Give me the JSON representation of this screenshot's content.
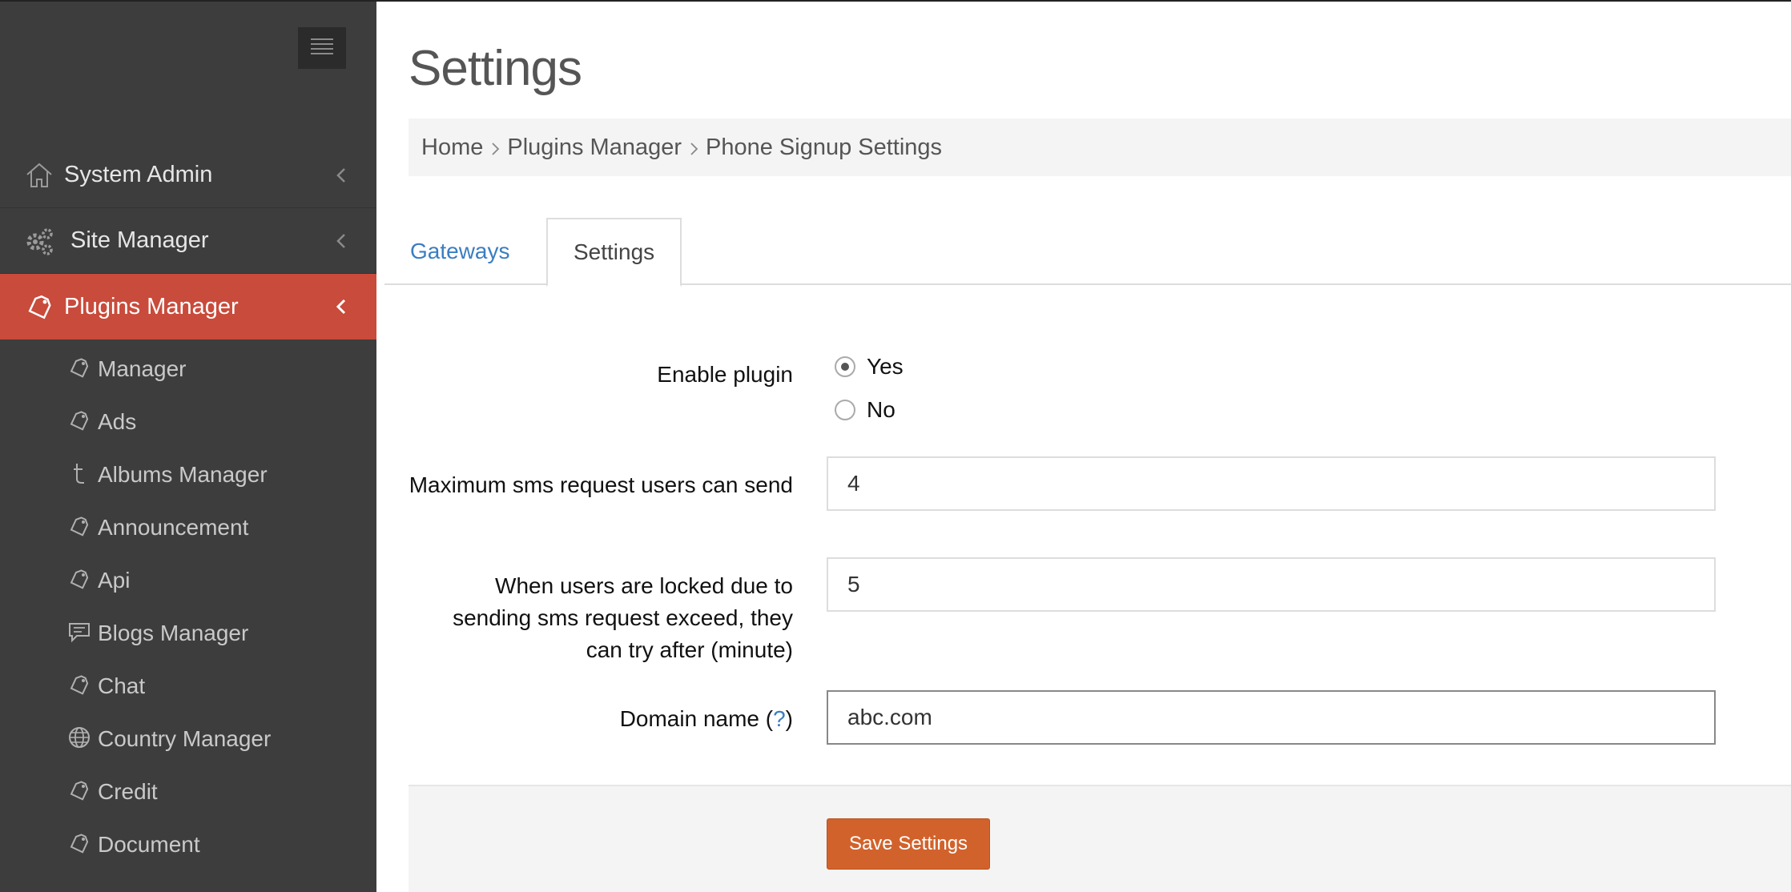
{
  "sidebar": {
    "menu": [
      {
        "label": "System Admin",
        "icon": "home-icon"
      },
      {
        "label": "Site Manager",
        "icon": "gears-icon"
      },
      {
        "label": "Plugins Manager",
        "icon": "plug-tag-icon"
      }
    ],
    "submenu": [
      {
        "label": "Manager",
        "icon": "plug-tag-icon"
      },
      {
        "label": "Ads",
        "icon": "plug-tag-icon"
      },
      {
        "label": "Albums Manager",
        "icon": "tumblr-icon"
      },
      {
        "label": "Announcement",
        "icon": "plug-tag-icon"
      },
      {
        "label": "Api",
        "icon": "plug-tag-icon"
      },
      {
        "label": "Blogs Manager",
        "icon": "comment-icon"
      },
      {
        "label": "Chat",
        "icon": "plug-tag-icon"
      },
      {
        "label": "Country Manager",
        "icon": "globe-icon"
      },
      {
        "label": "Credit",
        "icon": "plug-tag-icon"
      },
      {
        "label": "Document",
        "icon": "plug-tag-icon"
      }
    ],
    "active_color": "#c94b3b"
  },
  "header": {
    "title": "Settings",
    "breadcrumb": [
      "Home",
      "Plugins Manager",
      "Phone Signup Settings"
    ]
  },
  "tabs": [
    {
      "label": "Gateways",
      "active": false
    },
    {
      "label": "Settings",
      "active": true
    }
  ],
  "form": {
    "enable_plugin": {
      "label": "Enable plugin",
      "options": [
        "Yes",
        "No"
      ],
      "selected": "Yes"
    },
    "max_sms": {
      "label": "Maximum sms request users can send",
      "value": "4"
    },
    "lock_minutes": {
      "label": "When users are locked due to sending sms request exceed, they can try after (minute)",
      "value": "5"
    },
    "domain": {
      "label": "Domain name (",
      "help": "?",
      "label_end": ")",
      "value": "abc.com"
    },
    "save_label": "Save Settings"
  },
  "colors": {
    "accent_link": "#3a7ec2",
    "save_button": "#d2622b",
    "sidebar_bg": "#3d3d3d"
  }
}
